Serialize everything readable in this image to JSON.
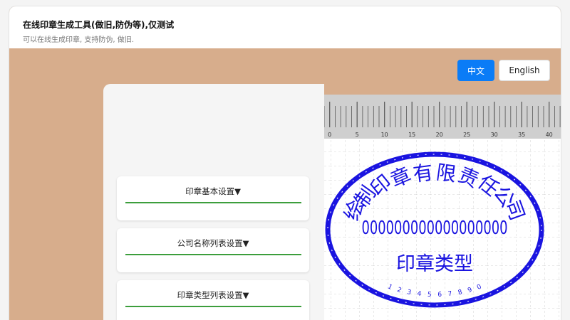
{
  "header": {
    "title": "在线印章生成工具(做旧,防伪等),仅测试",
    "subtitle": "可以在线生成印章, 支持防伪, 做旧."
  },
  "language": {
    "zh_label": "中文",
    "en_label": "English"
  },
  "sections": [
    {
      "label": "印章基本设置▼"
    },
    {
      "label": "公司名称列表设置▼"
    },
    {
      "label": "印章类型列表设置▼"
    }
  ],
  "ruler": {
    "labels": [
      "0",
      "5",
      "10",
      "15",
      "20",
      "25",
      "30",
      "35",
      "40"
    ]
  },
  "stamp": {
    "company_chars": [
      "绘",
      "制",
      "印",
      "章",
      "有",
      "限",
      "责",
      "任",
      "公",
      "司"
    ],
    "code": "000000000000000000",
    "type": "印章类型",
    "serial_chars": [
      "1",
      "2",
      "3",
      "4",
      "5",
      "6",
      "7",
      "8",
      "9",
      "0"
    ],
    "color": "#1a14e0"
  }
}
